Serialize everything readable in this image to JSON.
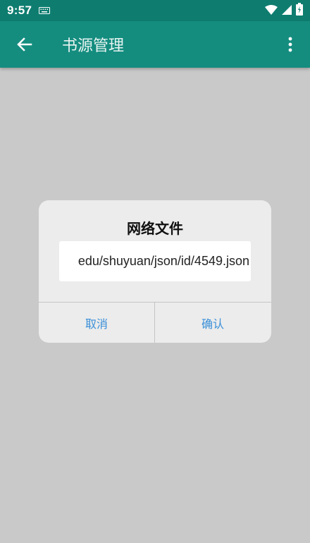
{
  "status_bar": {
    "time": "9:57",
    "icons": [
      "keyboard-icon",
      "wifi-icon",
      "signal-icon",
      "battery-charging-icon"
    ]
  },
  "toolbar": {
    "title": "书源管理",
    "back_icon": "arrow-left-icon",
    "more_icon": "more-vertical-icon",
    "color": "#148d7f"
  },
  "dialog": {
    "title": "网络文件",
    "url_value": "edu/shuyuan/json/id/4549.json",
    "cancel_label": "取消",
    "confirm_label": "确认",
    "button_color": "#3a8fd8"
  }
}
